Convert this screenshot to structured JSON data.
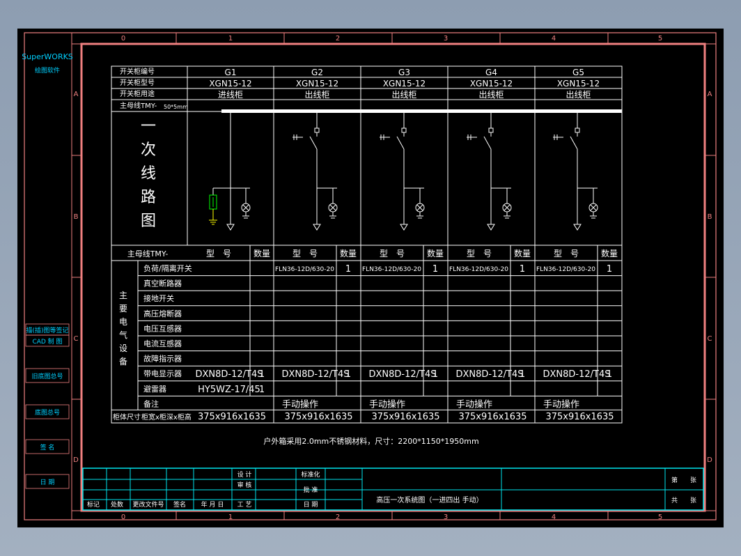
{
  "sidebar": {
    "brand": "SuperWORKS",
    "brand_sub": "绘图软件",
    "fields": [
      "描(插)图等签记",
      "CAD 制 图",
      "旧底图总号",
      "底图总号",
      "签 名",
      "日 期"
    ]
  },
  "border": {
    "col_labels": [
      "0",
      "1",
      "2",
      "3",
      "4",
      "5"
    ],
    "row_labels": [
      "A",
      "B",
      "C",
      "D"
    ]
  },
  "table": {
    "row_headers": [
      "开关柜编号",
      "开关柜型号",
      "开关柜用途"
    ],
    "busbar_label": "主母线TMY-",
    "busbar_spec": "50*5mm",
    "diagram_title_chars": [
      "一",
      "次",
      "线",
      "路",
      "图"
    ],
    "cabinets": [
      {
        "id": "G1",
        "model": "XGN15-12",
        "use": "进线柜"
      },
      {
        "id": "G2",
        "model": "XGN15-12",
        "use": "出线柜"
      },
      {
        "id": "G3",
        "model": "XGN15-12",
        "use": "出线柜"
      },
      {
        "id": "G4",
        "model": "XGN15-12",
        "use": "出线柜"
      },
      {
        "id": "G5",
        "model": "XGN15-12",
        "use": "出线柜"
      }
    ],
    "equip_header": {
      "busbar": "主母线TMY-",
      "type_label": "型　号",
      "qty_label": "数量"
    },
    "main_equipment_label": [
      "主",
      "要",
      "电",
      "气",
      "设",
      "备"
    ],
    "equipment_rows": [
      {
        "name": "负荷/隔离开关",
        "cells": [
          [
            "",
            ""
          ],
          [
            "FLN36-12D/630-20",
            "1"
          ],
          [
            "FLN36-12D/630-20",
            "1"
          ],
          [
            "FLN36-12D/630-20",
            "1"
          ],
          [
            "FLN36-12D/630-20",
            "1"
          ]
        ]
      },
      {
        "name": "真空断路器",
        "cells": [
          [
            "",
            ""
          ],
          [
            "",
            ""
          ],
          [
            "",
            ""
          ],
          [
            "",
            ""
          ],
          [
            "",
            ""
          ]
        ]
      },
      {
        "name": "接地开关",
        "cells": [
          [
            "",
            ""
          ],
          [
            "",
            ""
          ],
          [
            "",
            ""
          ],
          [
            "",
            ""
          ],
          [
            "",
            ""
          ]
        ]
      },
      {
        "name": "高压熔断器",
        "cells": [
          [
            "",
            ""
          ],
          [
            "",
            ""
          ],
          [
            "",
            ""
          ],
          [
            "",
            ""
          ],
          [
            "",
            ""
          ]
        ]
      },
      {
        "name": "电压互感器",
        "cells": [
          [
            "",
            ""
          ],
          [
            "",
            ""
          ],
          [
            "",
            ""
          ],
          [
            "",
            ""
          ],
          [
            "",
            ""
          ]
        ]
      },
      {
        "name": "电流互感器",
        "cells": [
          [
            "",
            ""
          ],
          [
            "",
            ""
          ],
          [
            "",
            ""
          ],
          [
            "",
            ""
          ],
          [
            "",
            ""
          ]
        ]
      },
      {
        "name": "故障指示器",
        "cells": [
          [
            "",
            ""
          ],
          [
            "",
            ""
          ],
          [
            "",
            ""
          ],
          [
            "",
            ""
          ],
          [
            "",
            ""
          ]
        ]
      },
      {
        "name": "带电显示器",
        "cells": [
          [
            "DXN8D-12/T4S",
            "1"
          ],
          [
            "DXN8D-12/T4S",
            "1"
          ],
          [
            "DXN8D-12/T4S",
            "1"
          ],
          [
            "DXN8D-12/T4S",
            "1"
          ],
          [
            "DXN8D-12/T4S",
            "1"
          ]
        ]
      },
      {
        "name": "避雷器",
        "cells": [
          [
            "HY5WZ-17/45",
            "1"
          ],
          [
            "",
            ""
          ],
          [
            "",
            ""
          ],
          [
            "",
            ""
          ],
          [
            "",
            ""
          ]
        ]
      }
    ],
    "remarks_label": "备注",
    "remarks": [
      "",
      "手动操作",
      "手动操作",
      "手动操作",
      "手动操作"
    ],
    "size_label_a": "柜体尺寸",
    "size_label_b": "柜宽x柜深x柜高",
    "sizes": [
      "375x916x1635",
      "375x916x1635",
      "375x916x1635",
      "375x916x1635",
      "375x916x1635"
    ]
  },
  "note": "户外箱采用2.0mm不锈钢材料，尺寸：2200*1150*1950mm",
  "title_block": {
    "bottom_labels": [
      "标记",
      "处数",
      "更改文件号",
      "签名",
      "年 月 日"
    ],
    "design_labels": [
      "设 计",
      "审 核",
      "工 艺"
    ],
    "approve_labels": [
      "标准化",
      "批 准",
      "日 期"
    ],
    "drawing_title": "高压一次系统图（一进四出 手动）",
    "sheet_labels": [
      "第　　张",
      "共　　张"
    ]
  },
  "colors": {
    "background": "#000000",
    "frame": "#f08080",
    "table_lines": "#ffffff",
    "title_block_lines": "#00e5ee",
    "text": "#ffffff",
    "border_labels": "#f08080",
    "sidebar_text": "#00d0ff",
    "earth_symbol": "#ffff00",
    "arrester_symbol": "#00ff00"
  }
}
